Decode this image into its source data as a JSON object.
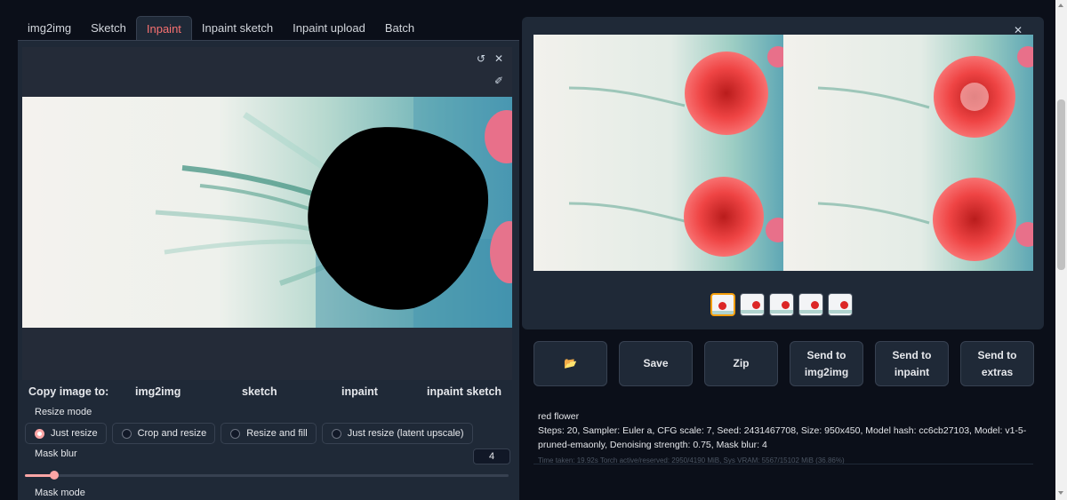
{
  "tabs": [
    "img2img",
    "Sketch",
    "Inpaint",
    "Inpaint sketch",
    "Inpaint upload",
    "Batch"
  ],
  "active_tab": "Inpaint",
  "canvas": {
    "undo_icon": "↺",
    "clear_icon": "✕",
    "brush_icon": "✐"
  },
  "copy_image": {
    "label": "Copy image to:",
    "targets": [
      "img2img",
      "sketch",
      "inpaint",
      "inpaint sketch"
    ]
  },
  "resize_mode": {
    "label": "Resize mode",
    "options": [
      "Just resize",
      "Crop and resize",
      "Resize and fill",
      "Just resize (latent upscale)"
    ],
    "selected": "Just resize"
  },
  "mask_blur": {
    "label": "Mask blur",
    "value": "4",
    "fraction": 0.06
  },
  "mask_mode": {
    "label": "Mask mode"
  },
  "gallery": {
    "close_icon": "✕",
    "thumb_count": 5,
    "selected_index": 0
  },
  "actions": {
    "folder_icon": "📂",
    "save": "Save",
    "zip": "Zip",
    "send_img2img": "Send to img2img",
    "send_inpaint": "Send to inpaint",
    "send_extras": "Send to extras"
  },
  "generation_info": {
    "prompt": "red flower",
    "params": "Steps: 20, Sampler: Euler a, CFG scale: 7, Seed: 2431467708, Size: 950x450, Model hash: cc6cb27103, Model: v1-5-pruned-emaonly, Denoising strength: 0.75, Mask blur: 4",
    "timing": "Time taken: 19.92s  Torch active/reserved: 2950/4190 MiB, Sys VRAM: 5567/15102 MiB (36.86%)"
  },
  "colors": {
    "accent": "#f87171",
    "background": "#0b0f19",
    "panel": "#1f2937",
    "selected_thumb": "#f59e0b"
  }
}
